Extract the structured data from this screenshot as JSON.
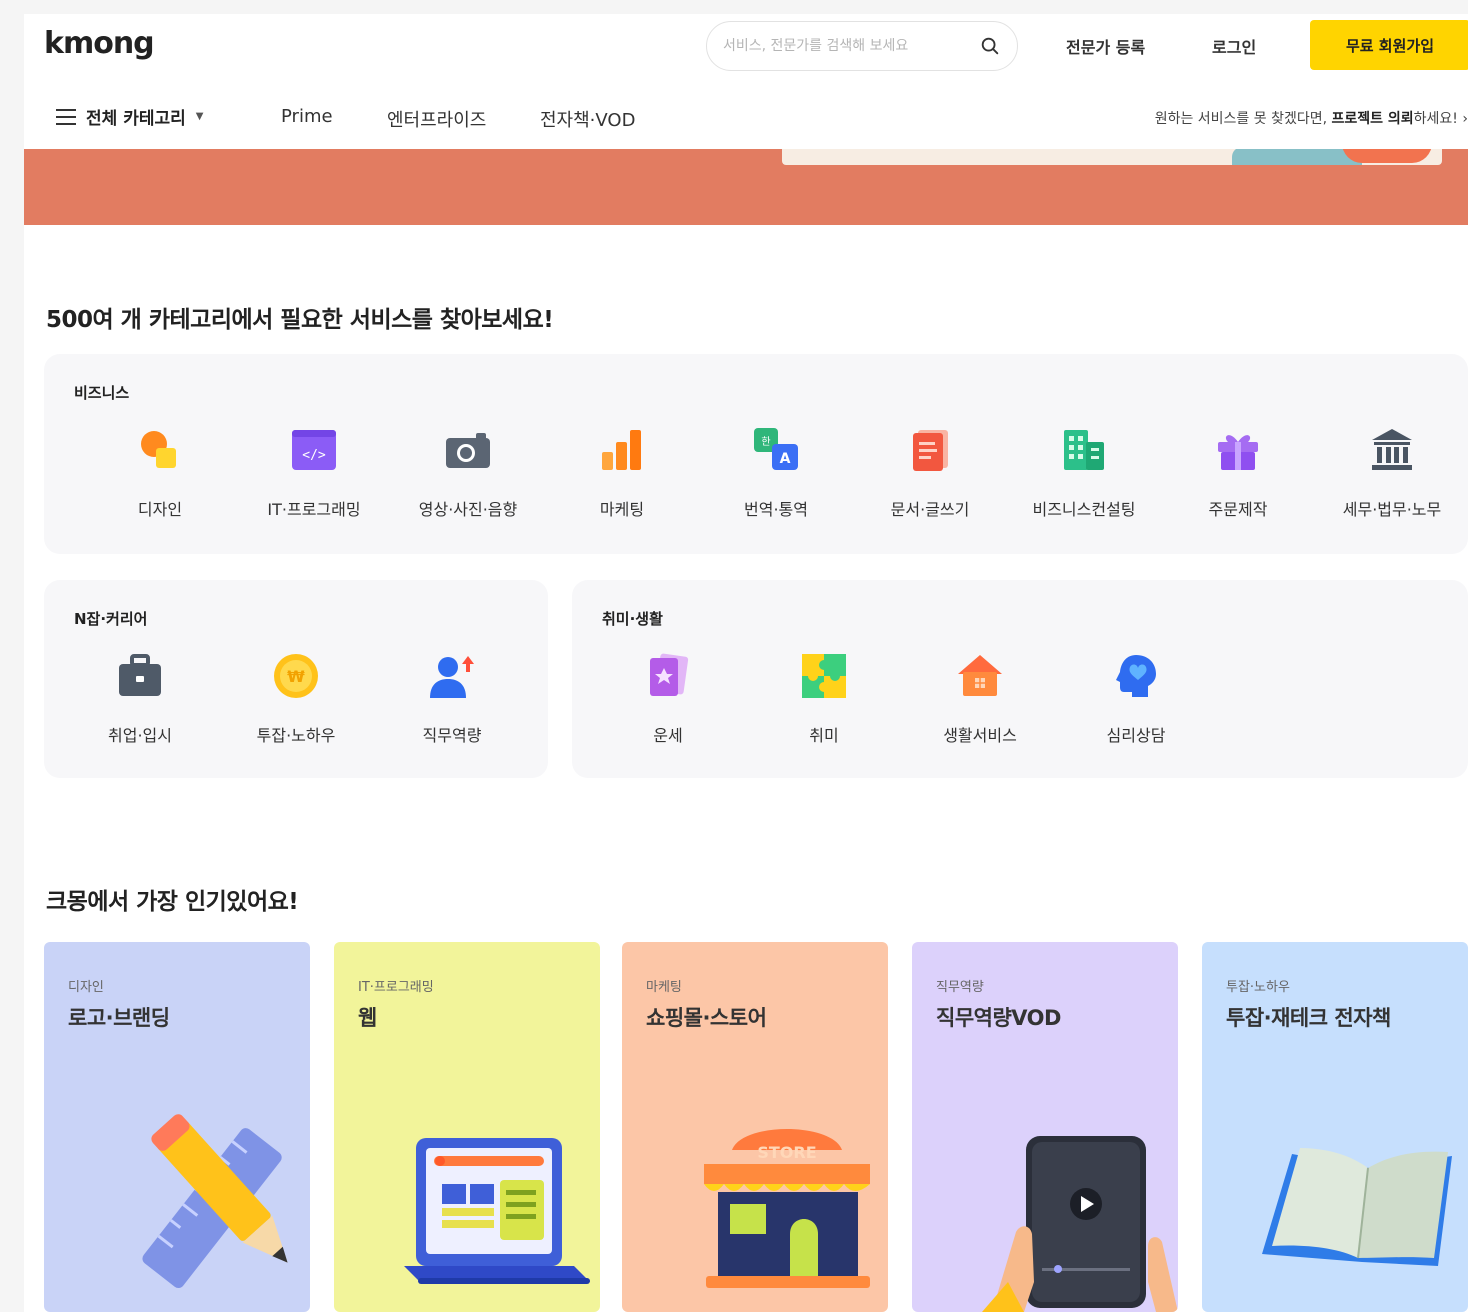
{
  "header": {
    "logo": "kmong",
    "search_placeholder": "서비스, 전문가를 검색해 보세요",
    "expert_register": "전문가 등록",
    "login": "로그인",
    "signup": "무료 회원가입"
  },
  "nav": {
    "all_categories": "전체 카테고리",
    "prime": "Prime",
    "enterprise": "엔터프라이즈",
    "ebook_vod": "전자책·VOD",
    "promo_prefix": "원하는 서비스를 못 찾겠다면, ",
    "promo_bold": "프로젝트 의뢰",
    "promo_suffix": "하세요!",
    "promo_arrow": "›"
  },
  "categories_section": {
    "title": "500여 개 카테고리에서 필요한 서비스를 찾아보세요!",
    "business": {
      "title": "비즈니스",
      "items": [
        {
          "label": "디자인",
          "icon": "design-icon"
        },
        {
          "label": "IT·프로그래밍",
          "icon": "code-icon"
        },
        {
          "label": "영상·사진·음향",
          "icon": "camera-icon"
        },
        {
          "label": "마케팅",
          "icon": "bar-chart-icon"
        },
        {
          "label": "번역·통역",
          "icon": "translate-icon"
        },
        {
          "label": "문서·글쓰기",
          "icon": "document-icon"
        },
        {
          "label": "비즈니스컨설팅",
          "icon": "building-icon"
        },
        {
          "label": "주문제작",
          "icon": "gift-icon"
        },
        {
          "label": "세무·법무·노무",
          "icon": "bank-icon"
        }
      ]
    },
    "njob": {
      "title": "N잡·커리어",
      "items": [
        {
          "label": "취업·입시",
          "icon": "briefcase-icon"
        },
        {
          "label": "투잡·노하우",
          "icon": "coin-icon"
        },
        {
          "label": "직무역량",
          "icon": "person-up-icon"
        }
      ]
    },
    "hobby": {
      "title": "취미·생활",
      "items": [
        {
          "label": "운세",
          "icon": "tarot-card-icon"
        },
        {
          "label": "취미",
          "icon": "puzzle-icon"
        },
        {
          "label": "생활서비스",
          "icon": "house-icon"
        },
        {
          "label": "심리상담",
          "icon": "heart-head-icon"
        }
      ]
    }
  },
  "popular_section": {
    "title": "크몽에서 가장 인기있어요!",
    "cards": [
      {
        "category": "디자인",
        "title": "로고·브랜딩",
        "bg": "#c9d3f7",
        "art": "pencil-ruler-icon"
      },
      {
        "category": "IT·프로그래밍",
        "title": "웹",
        "bg": "#f2f49a",
        "art": "laptop-web-icon"
      },
      {
        "category": "마케팅",
        "title": "쇼핑몰·스토어",
        "bg": "#fcc6a7",
        "art": "store-icon",
        "art_text": "STORE"
      },
      {
        "category": "직무역량",
        "title": "직무역량VOD",
        "bg": "#dcd1fb",
        "art": "tablet-video-icon"
      },
      {
        "category": "투잡·노하우",
        "title": "투잡·재테크 전자책",
        "bg": "#c6dffd",
        "art": "open-book-icon"
      }
    ]
  },
  "colors": {
    "brand_yellow": "#ffd400",
    "banner": "#e27c61"
  }
}
